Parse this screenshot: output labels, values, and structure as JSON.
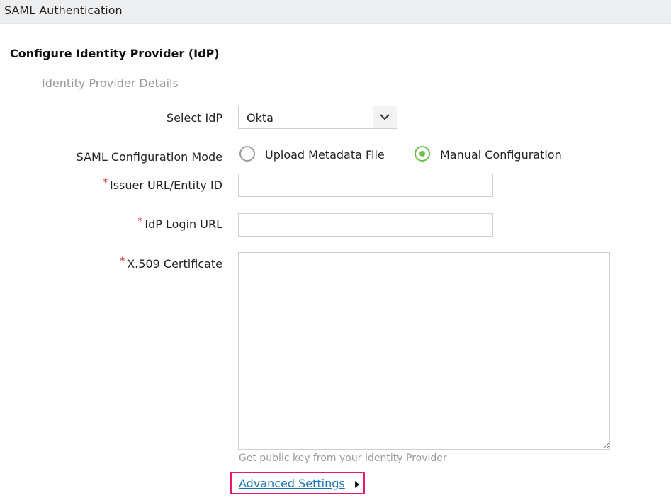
{
  "header": {
    "title": "SAML Authentication"
  },
  "section": {
    "title": "Configure Identity Provider (IdP)",
    "subtitle": "Identity Provider Details"
  },
  "form": {
    "select_idp": {
      "label": "Select IdP",
      "value": "Okta"
    },
    "mode": {
      "label": "SAML Configuration Mode",
      "options": [
        {
          "label": "Upload Metadata File",
          "selected": false
        },
        {
          "label": "Manual Configuration",
          "selected": true
        }
      ]
    },
    "issuer_url": {
      "label": "Issuer URL/Entity ID",
      "required_mark": "*",
      "value": ""
    },
    "idp_login_url": {
      "label": "IdP Login URL",
      "required_mark": "*",
      "value": ""
    },
    "certificate": {
      "label": "X.509 Certificate",
      "required_mark": "*",
      "value": "",
      "hint": "Get public key from your Identity Provider"
    },
    "advanced_settings": {
      "label": "Advanced Settings"
    }
  },
  "colors": {
    "required": "#e02020",
    "radio_selected": "#6cc04a",
    "link": "#1a73b8",
    "highlight_border": "#e8186b"
  }
}
